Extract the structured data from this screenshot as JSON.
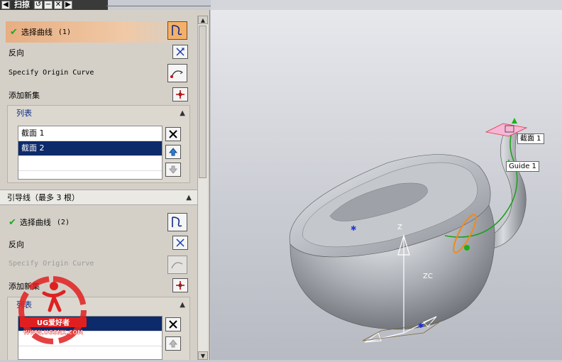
{
  "titlebar": {
    "title": "扫掠"
  },
  "section1": {
    "select_curve_label": "选择曲线",
    "select_curve_count": "(1)",
    "reverse_label": "反向",
    "origin_curve_label": "Specify Origin Curve",
    "add_new_set_label": "添加新集",
    "list_label": "列表",
    "list_items": [
      "截面 1",
      "截面 2"
    ]
  },
  "section2": {
    "header_label": "引导线（最多 3 根）",
    "select_curve_label": "选择曲线",
    "select_curve_count": "(2)",
    "reverse_label": "反向",
    "origin_curve_label": "Specify Origin Curve",
    "add_new_set_label": "添加新集",
    "list_label": "列表",
    "list_items": [
      "Guide 1"
    ]
  },
  "viewport": {
    "section_label": "截面 1",
    "guide_label": "Guide 1",
    "axis_z": "Z",
    "axis_zc": "ZC"
  },
  "watermark": {
    "text_cn": "UG爱好者",
    "url": "WWW.UGSNX.COM"
  },
  "colors": {
    "list_selected": "#0d2a6b",
    "highlight": "#e7ae82",
    "check": "#1ea91e",
    "list_header": "#0b2f8a"
  }
}
